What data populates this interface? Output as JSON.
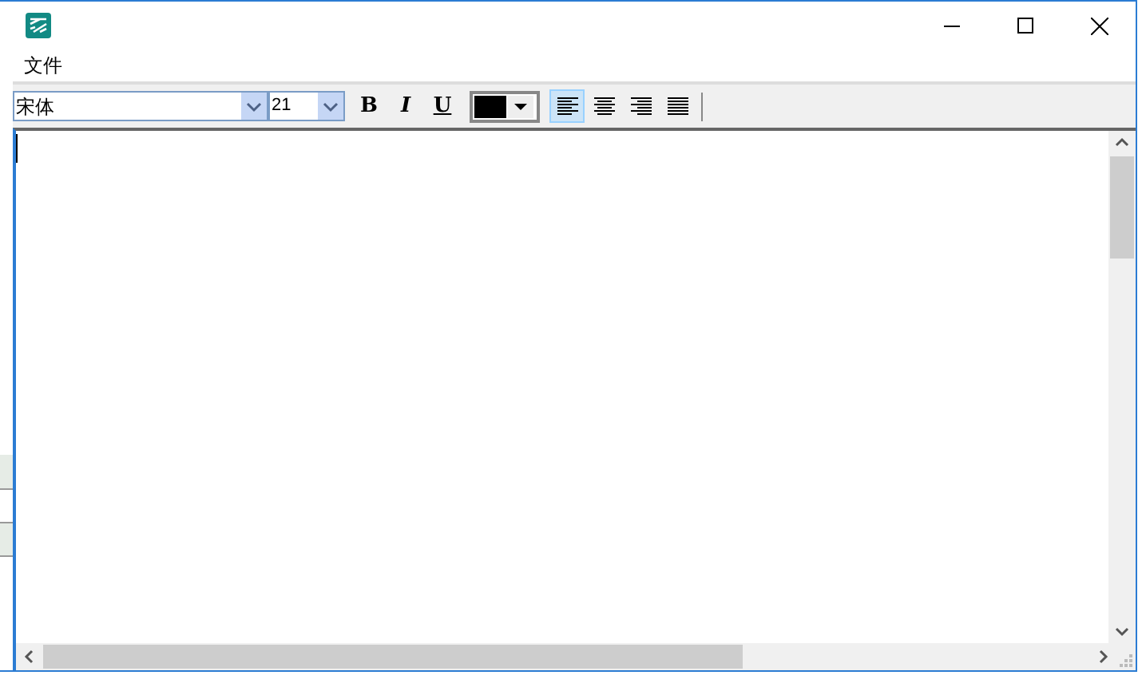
{
  "menu": [
    {
      "label": "文件"
    }
  ],
  "toolbar": {
    "font": {
      "value": "宋体"
    },
    "size": {
      "value": "21"
    },
    "format_buttons": [
      {
        "kind": "bold",
        "label": "B",
        "selected": false
      },
      {
        "kind": "italic",
        "label": "I",
        "selected": false
      },
      {
        "kind": "underline",
        "label": "U",
        "selected": false
      }
    ],
    "text_color": {
      "color": "#000000"
    },
    "align_buttons": [
      {
        "kind": "left",
        "selected": true
      },
      {
        "kind": "center",
        "selected": false
      },
      {
        "kind": "right",
        "selected": false
      },
      {
        "kind": "justify",
        "selected": false
      }
    ]
  }
}
